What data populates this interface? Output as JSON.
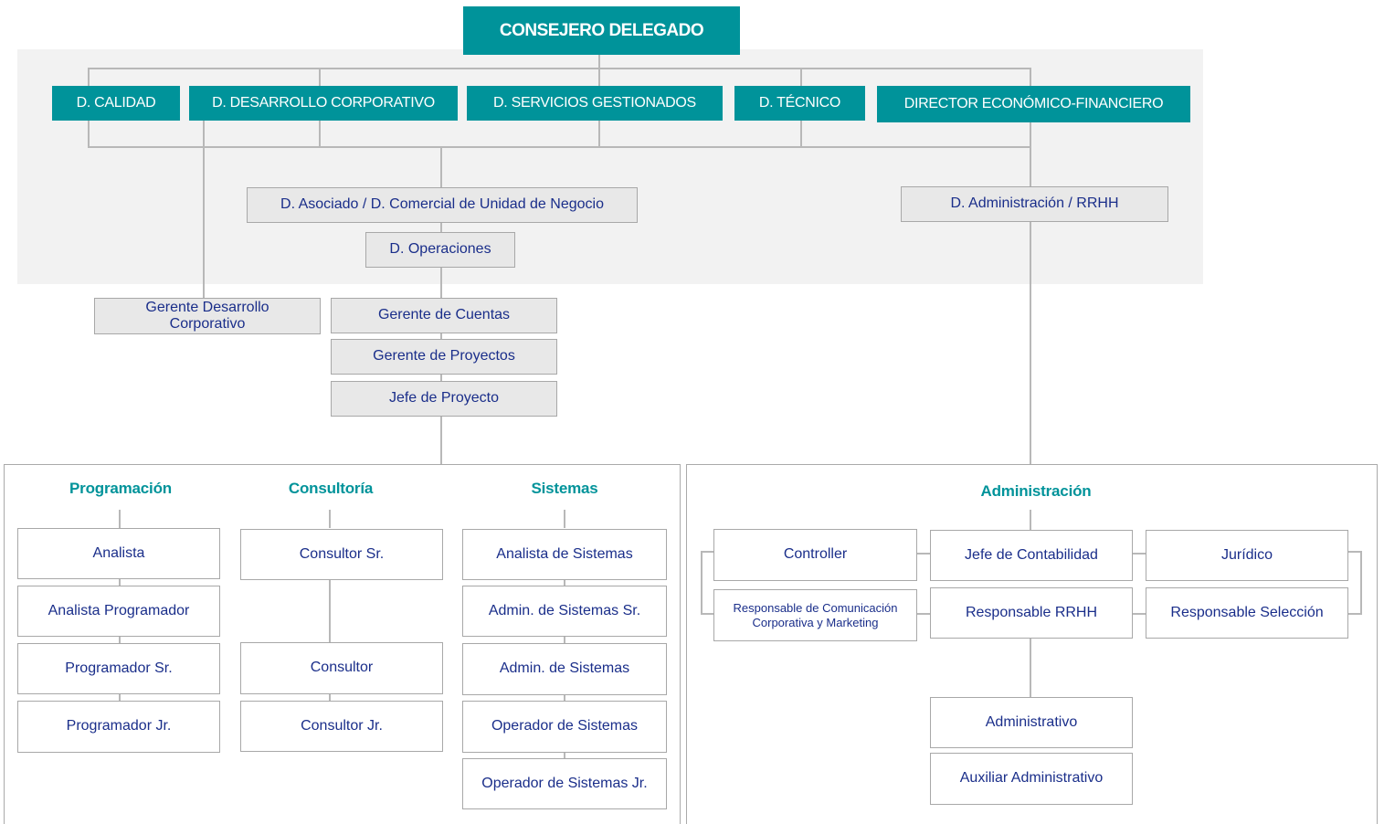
{
  "top": {
    "title": "CONSEJERO DELEGADO"
  },
  "directors": {
    "calidad": "D. CALIDAD",
    "desarrollo": "D. DESARROLLO CORPORATIVO",
    "servicios": "D. SERVICIOS GESTIONADOS",
    "tecnico": "D. TÉCNICO",
    "financiero": "DIRECTOR ECONÓMICO-FINANCIERO"
  },
  "middle": {
    "asociado": "D. Asociado / D. Comercial de Unidad de Negocio",
    "operaciones": "D. Operaciones",
    "administracion_rrhh": "D. Administración / RRHH",
    "gerente_desarrollo": "Gerente Desarrollo Corporativo",
    "gerente_cuentas": "Gerente de Cuentas",
    "gerente_proyectos": "Gerente de Proyectos",
    "jefe_proyecto": "Jefe de Proyecto"
  },
  "programacion": {
    "heading": "Programación",
    "roles": [
      "Analista",
      "Analista Programador",
      "Programador Sr.",
      "Programador Jr."
    ]
  },
  "consultoria": {
    "heading": "Consultoría",
    "roles": [
      "Consultor Sr.",
      "Consultor",
      "Consultor Jr."
    ]
  },
  "sistemas": {
    "heading": "Sistemas",
    "roles": [
      "Analista de Sistemas",
      "Admin. de Sistemas Sr.",
      "Admin. de Sistemas",
      "Operador de Sistemas",
      "Operador de Sistemas Jr."
    ]
  },
  "administracion": {
    "heading": "Administración",
    "controller": "Controller",
    "comunicacion": "Responsable de Comunicación Corporativa y Marketing",
    "jefe_contabilidad": "Jefe de Contabilidad",
    "responsable_rrhh": "Responsable RRHH",
    "juridico": "Jurídico",
    "responsable_seleccion": "Responsable Selección",
    "administrativo": "Administrativo",
    "auxiliar": "Auxiliar Administrativo"
  },
  "colors": {
    "teal": "#00939a",
    "text_blue": "#1a2e8a",
    "band_gray": "#f2f2f2",
    "line_gray": "#b8b8b8"
  }
}
